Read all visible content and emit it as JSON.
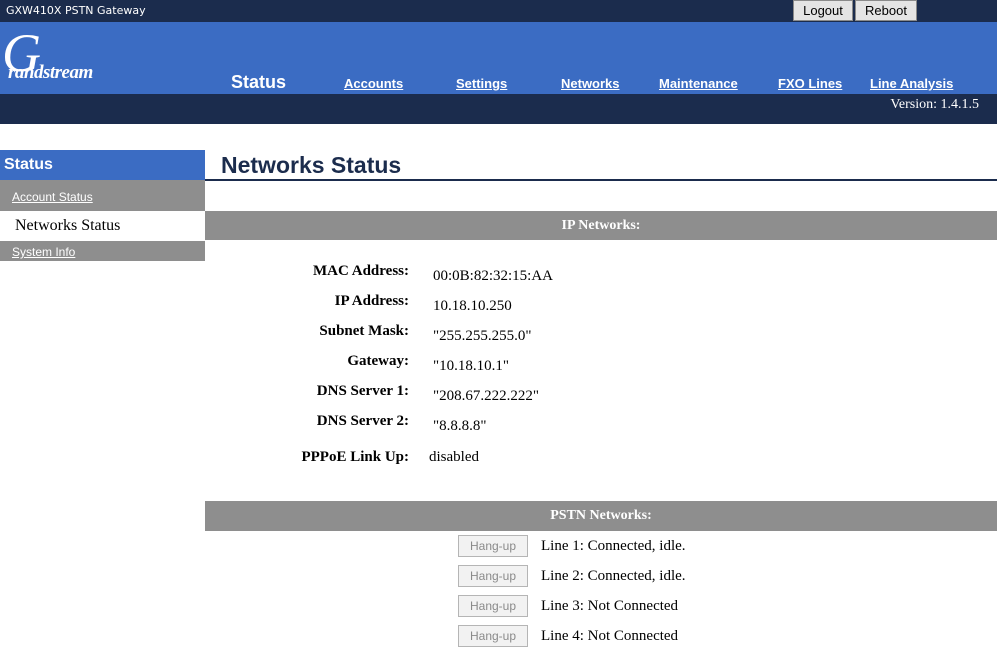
{
  "top_bar": {
    "product_name": "GXW410X PSTN Gateway",
    "logout_label": "Logout",
    "reboot_label": "Reboot"
  },
  "header": {
    "logo_letter": "G",
    "logo_text": "randstream",
    "active_tab": "Status",
    "nav": [
      {
        "label": "Accounts"
      },
      {
        "label": "Settings"
      },
      {
        "label": "Networks"
      },
      {
        "label": "Maintenance"
      },
      {
        "label": "FXO Lines"
      },
      {
        "label": "Line Analysis"
      }
    ],
    "version": "Version: 1.4.1.5"
  },
  "sidebar": {
    "title": "Status",
    "items": [
      {
        "label": "Account Status"
      },
      {
        "label": "Networks Status"
      },
      {
        "label": "System Info"
      }
    ]
  },
  "main": {
    "title": "Networks Status",
    "ip_networks": {
      "heading": "IP Networks:",
      "fields": [
        {
          "label": "MAC Address:",
          "value": "00:0B:82:32:15:AA"
        },
        {
          "label": "IP Address:",
          "value": "10.18.10.250"
        },
        {
          "label": "Subnet Mask:",
          "value": "\"255.255.255.0\""
        },
        {
          "label": "Gateway:",
          "value": "\"10.18.10.1\""
        },
        {
          "label": "DNS Server 1:",
          "value": "\"208.67.222.222\""
        },
        {
          "label": "DNS Server 2:",
          "value": "\"8.8.8.8\""
        },
        {
          "label": "PPPoE Link Up:",
          "value": "disabled"
        }
      ]
    },
    "pstn_networks": {
      "heading": "PSTN Networks:",
      "hangup_label": "Hang-up",
      "lines": [
        {
          "status": "Line 1: Connected, idle."
        },
        {
          "status": "Line 2: Connected, idle."
        },
        {
          "status": "Line 3: Not Connected"
        },
        {
          "status": "Line 4: Not Connected"
        }
      ]
    }
  },
  "colors": {
    "dark_navy": "#1b2c4d",
    "header_blue": "#3b6cc3",
    "section_grey": "#8e8e8e"
  }
}
